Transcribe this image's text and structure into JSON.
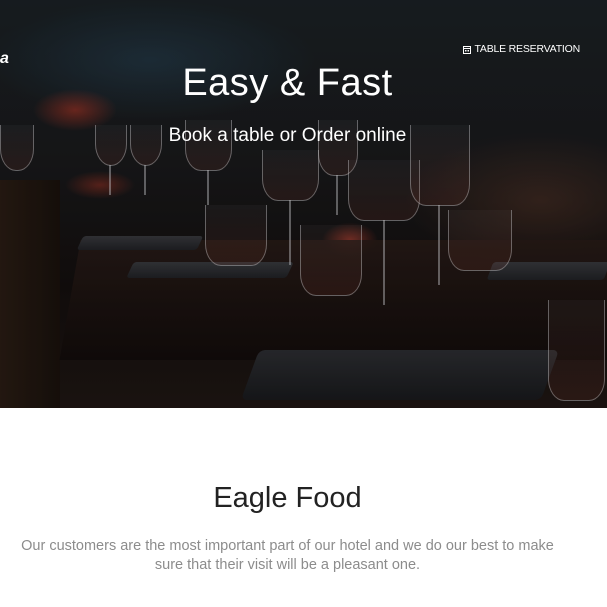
{
  "header": {
    "brand_fragment": "a",
    "reservation_label": "TABLE RESERVATION",
    "reservation_icon": "calendar-icon"
  },
  "hero": {
    "title": "Easy & Fast",
    "subtitle": "Book a table or Order online"
  },
  "about": {
    "title": "Eagle Food",
    "description": "Our customers are the most important part of our hotel and we do our best to make sure that their visit will be a pleasant one."
  },
  "colors": {
    "hero_text": "#ffffff",
    "heading": "#222222",
    "body_text": "#8c8c8c",
    "background": "#ffffff"
  }
}
